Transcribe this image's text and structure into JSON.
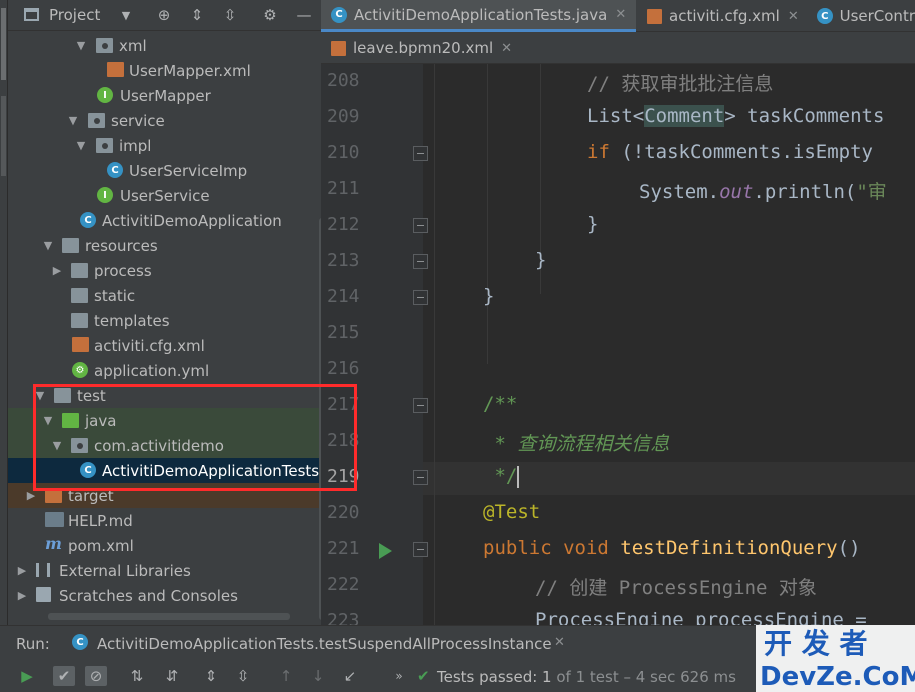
{
  "project": {
    "title": "Project",
    "tree": [
      {
        "label": "xml",
        "icon": "folder"
      },
      {
        "label": "UserMapper.xml",
        "icon": "xml-file-icon"
      },
      {
        "label": "UserMapper",
        "icon": "interface-icon"
      },
      {
        "label": "service",
        "icon": "folder"
      },
      {
        "label": "impl",
        "icon": "folder"
      },
      {
        "label": "UserServiceImp",
        "icon": "class-icon"
      },
      {
        "label": "UserService",
        "icon": "interface-icon"
      },
      {
        "label": "ActivitiDemoApplication",
        "icon": "spring-boot-class-icon"
      },
      {
        "label": "resources",
        "icon": "resources-folder"
      },
      {
        "label": "process",
        "icon": "folder"
      },
      {
        "label": "static",
        "icon": "folder"
      },
      {
        "label": "templates",
        "icon": "folder"
      },
      {
        "label": "activiti.cfg.xml",
        "icon": "xml-file-icon"
      },
      {
        "label": "application.yml",
        "icon": "yml-file-icon"
      },
      {
        "label": "test",
        "icon": "folder"
      },
      {
        "label": "java",
        "icon": "test-source-folder"
      },
      {
        "label": "com.activitidemo",
        "icon": "package"
      },
      {
        "label": "ActivitiDemoApplicationTests",
        "icon": "test-class-icon"
      },
      {
        "label": "target",
        "icon": "excluded-folder"
      },
      {
        "label": "HELP.md",
        "icon": "markdown-file-icon"
      },
      {
        "label": "pom.xml",
        "icon": "maven-icon"
      },
      {
        "label": "External Libraries",
        "icon": "libraries-icon"
      },
      {
        "label": "Scratches and Consoles",
        "icon": "scratches-icon"
      }
    ]
  },
  "tabs_row1": [
    "ActivitiDemoApplicationTests.java",
    "activiti.cfg.xml",
    "UserContr"
  ],
  "tabs_row2": [
    "leave.bpmn20.xml"
  ],
  "editor": {
    "line_numbers": [
      "208",
      "209",
      "210",
      "211",
      "212",
      "213",
      "214",
      "215",
      "216",
      "217",
      "218",
      "219",
      "220",
      "221",
      "222",
      "223"
    ],
    "code": {
      "l208": "// 获取审批批注信息",
      "l209_a": "List<",
      "l209_b": "Comment",
      "l209_c": "> taskComments",
      "l210_a": "if",
      "l210_b": " (!taskComments.isEmpty",
      "l211_a": "System.",
      "l211_b": "out",
      "l211_c": ".println(",
      "l211_d": "\"审",
      "l212": "}",
      "l213": "}",
      "l214": "}",
      "l217": "/**",
      "l218_a": " * ",
      "l218_b": "查询流程相关信息",
      "l219": " */",
      "l220": "@Test",
      "l221_a": "public void ",
      "l221_b": "testDefinitionQuery",
      "l221_c": "()",
      "l222": "// 创建 ProcessEngine 对象",
      "l223": "ProcessEngine processEngine ="
    }
  },
  "run": {
    "label": "Run:",
    "config": "ActivitiDemoApplicationTests.testSuspendAllProcessInstance",
    "status_bold": "Tests passed: 1",
    "status_rest": " of 1 test – 4 sec 626 ms"
  },
  "watermark": {
    "top": "开 发 者",
    "bottom": "DevZe.CoM"
  },
  "colors": {
    "highlight_box": "#ff2b2b",
    "accent": "#4a88c7",
    "success": "#499c54"
  }
}
